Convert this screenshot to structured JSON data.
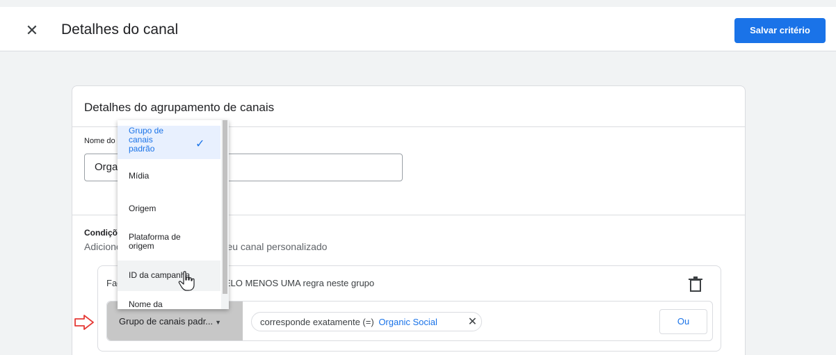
{
  "topbar": {
    "title": "Detalhes do canal",
    "save_label": "Salvar critério"
  },
  "card": {
    "title": "Detalhes do agrupamento de canais",
    "name_label": "Nome do canal",
    "name_value": "Organic Social",
    "conditions_title": "Condições",
    "conditions_subtitle": "Adicione condições para definir seu canal personalizado",
    "rule_group_text": "Faça a correspondência de PELO MENOS UMA regra neste grupo",
    "dimension_value": "Grupo de canais padr...",
    "condition_operator": "corresponde exatamente (=)",
    "condition_value": "Organic Social",
    "or_label": "Ou"
  },
  "dropdown": {
    "items": [
      "Grupo de canais padrão",
      "Mídia",
      "Origem",
      "Plataforma de origem",
      "ID da campanha",
      "Nome da campanha"
    ],
    "selected_index": 0,
    "hover_index": 4
  },
  "colors": {
    "accent": "#1a73e8",
    "dimension_bg": "#c7c7c7",
    "annotation_arrow": "#e53935"
  }
}
